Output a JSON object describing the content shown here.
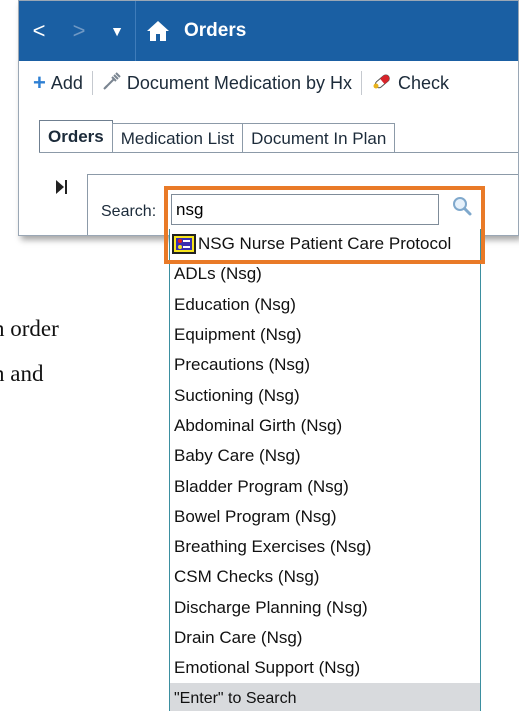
{
  "background_text": {
    "line1": "n order",
    "line2": "n and"
  },
  "titlebar": {
    "back_glyph": "<",
    "forward_glyph": ">",
    "dropdown_glyph": "▼",
    "title": "Orders"
  },
  "toolbar": {
    "add_label": "Add",
    "document_med_label": "Document Medication by Hx",
    "check_label": "Check"
  },
  "tabs": [
    {
      "label": "Orders"
    },
    {
      "label": "Medication List"
    },
    {
      "label": "Document In Plan"
    }
  ],
  "search": {
    "label": "Search:",
    "value": "nsg"
  },
  "results": [
    {
      "label": "NSG Nurse Patient Care Protocol"
    },
    {
      "label": "ADLs (Nsg)"
    },
    {
      "label": "Education (Nsg)"
    },
    {
      "label": "Equipment (Nsg)"
    },
    {
      "label": "Precautions (Nsg)"
    },
    {
      "label": "Suctioning (Nsg)"
    },
    {
      "label": "Abdominal Girth (Nsg)"
    },
    {
      "label": "Baby Care (Nsg)"
    },
    {
      "label": "Bladder Program (Nsg)"
    },
    {
      "label": "Bowel Program (Nsg)"
    },
    {
      "label": "Breathing Exercises (Nsg)"
    },
    {
      "label": "CSM Checks (Nsg)"
    },
    {
      "label": "Discharge Planning (Nsg)"
    },
    {
      "label": "Drain Care (Nsg)"
    },
    {
      "label": "Emotional Support (Nsg)"
    }
  ],
  "results_footer": "\"Enter\" to Search",
  "colors": {
    "titlebar": "#1a5fa3",
    "highlight": "#e97a27",
    "dropdown_border": "#3b8fa0"
  }
}
